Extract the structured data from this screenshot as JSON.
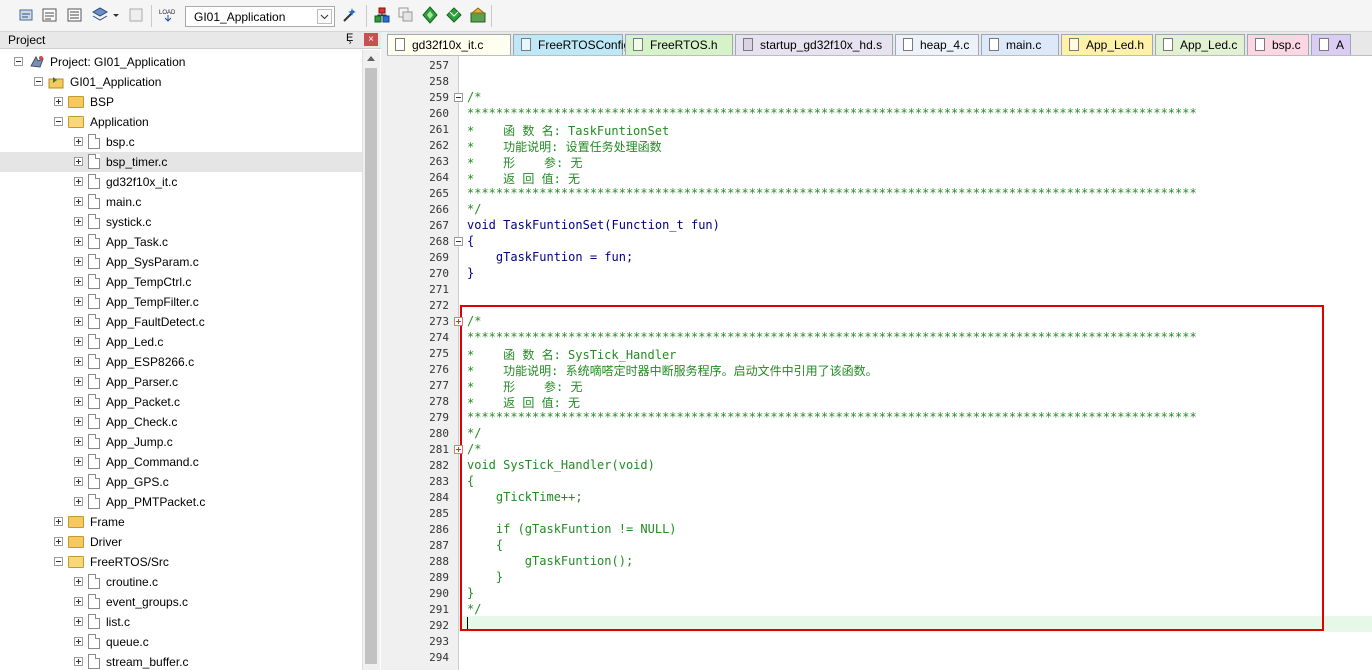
{
  "toolbar": {
    "target": "GI01_Application",
    "icons": [
      "translate-icon",
      "build-icon",
      "rebuild-icon",
      "batch-build-icon",
      "dropdown-arrow-icon",
      "stop-build-icon",
      "download-icon",
      "target-options-icon",
      "manage-components-icon",
      "file-extensions-icon",
      "select-packs-icon",
      "pack-installer-icon",
      "env-icon"
    ]
  },
  "project_panel": {
    "title": "Project",
    "pin": "Ȩ",
    "close": "×",
    "tree": [
      {
        "label": "Project: GI01_Application",
        "level": 0,
        "type": "project",
        "expanded": true
      },
      {
        "label": "GI01_Application",
        "level": 1,
        "type": "target",
        "expanded": true
      },
      {
        "label": "BSP",
        "level": 2,
        "type": "folder",
        "expanded": false
      },
      {
        "label": "Application",
        "level": 2,
        "type": "folder",
        "expanded": true
      },
      {
        "label": "bsp.c",
        "level": 3,
        "type": "file"
      },
      {
        "label": "bsp_timer.c",
        "level": 3,
        "type": "file",
        "selected": true
      },
      {
        "label": "gd32f10x_it.c",
        "level": 3,
        "type": "file"
      },
      {
        "label": "main.c",
        "level": 3,
        "type": "file"
      },
      {
        "label": "systick.c",
        "level": 3,
        "type": "file"
      },
      {
        "label": "App_Task.c",
        "level": 3,
        "type": "file"
      },
      {
        "label": "App_SysParam.c",
        "level": 3,
        "type": "file"
      },
      {
        "label": "App_TempCtrl.c",
        "level": 3,
        "type": "file"
      },
      {
        "label": "App_TempFilter.c",
        "level": 3,
        "type": "file"
      },
      {
        "label": "App_FaultDetect.c",
        "level": 3,
        "type": "file"
      },
      {
        "label": "App_Led.c",
        "level": 3,
        "type": "file"
      },
      {
        "label": "App_ESP8266.c",
        "level": 3,
        "type": "file"
      },
      {
        "label": "App_Parser.c",
        "level": 3,
        "type": "file"
      },
      {
        "label": "App_Packet.c",
        "level": 3,
        "type": "file"
      },
      {
        "label": "App_Check.c",
        "level": 3,
        "type": "file"
      },
      {
        "label": "App_Jump.c",
        "level": 3,
        "type": "file"
      },
      {
        "label": "App_Command.c",
        "level": 3,
        "type": "file"
      },
      {
        "label": "App_GPS.c",
        "level": 3,
        "type": "file"
      },
      {
        "label": "App_PMTPacket.c",
        "level": 3,
        "type": "file"
      },
      {
        "label": "Frame",
        "level": 2,
        "type": "folder",
        "expanded": false
      },
      {
        "label": "Driver",
        "level": 2,
        "type": "folder",
        "expanded": false
      },
      {
        "label": "FreeRTOS/Src",
        "level": 2,
        "type": "folder",
        "expanded": true
      },
      {
        "label": "croutine.c",
        "level": 3,
        "type": "file"
      },
      {
        "label": "event_groups.c",
        "level": 3,
        "type": "file"
      },
      {
        "label": "list.c",
        "level": 3,
        "type": "file"
      },
      {
        "label": "queue.c",
        "level": 3,
        "type": "file"
      },
      {
        "label": "stream_buffer.c",
        "level": 3,
        "type": "file"
      }
    ]
  },
  "tabs": [
    {
      "label": "gd32f10x_it.c",
      "color": "#fffff0",
      "icon": "#ffffff"
    },
    {
      "label": "FreeRTOSConfig.h",
      "color": "#bfe8f6",
      "icon": "#e6f6fb"
    },
    {
      "label": "FreeRTOS.h",
      "color": "#d6f2c8",
      "icon": "#f0fbea"
    },
    {
      "label": "startup_gd32f10x_hd.s",
      "color": "#e7e2f0",
      "icon": "#d9d3e5"
    },
    {
      "label": "heap_4.c",
      "color": "#ecf1fa",
      "icon": "#ffffff"
    },
    {
      "label": "main.c",
      "color": "#dde8f9",
      "icon": "#ffffff"
    },
    {
      "label": "App_Led.h",
      "color": "#fff2a8",
      "icon": "#fffbe0"
    },
    {
      "label": "App_Led.c",
      "color": "#e2f1d2",
      "icon": "#ffffff"
    },
    {
      "label": "bsp.c",
      "color": "#fcd7e3",
      "icon": "#ffffff"
    },
    {
      "label": "A",
      "color": "#d9cdf4",
      "icon": "#ffffff"
    }
  ],
  "editor": {
    "lines": [
      {
        "n": "257",
        "t": "",
        "s": "norm"
      },
      {
        "n": "258",
        "t": "",
        "s": "norm"
      },
      {
        "n": "259",
        "t": "/*",
        "s": "com",
        "fold": "open"
      },
      {
        "n": "260",
        "t": "*****************************************************************************************************",
        "s": "com"
      },
      {
        "n": "261",
        "t": "*    函 数 名: TaskFuntionSet",
        "s": "com"
      },
      {
        "n": "262",
        "t": "*    功能说明: 设置任务处理函数",
        "s": "com"
      },
      {
        "n": "263",
        "t": "*    形    参: 无",
        "s": "com"
      },
      {
        "n": "264",
        "t": "*    返 回 值: 无",
        "s": "com"
      },
      {
        "n": "265",
        "t": "*****************************************************************************************************",
        "s": "com"
      },
      {
        "n": "266",
        "t": "*/",
        "s": "com"
      },
      {
        "n": "267",
        "t": "void TaskFuntionSet(Function_t fun)",
        "s": "norm"
      },
      {
        "n": "268",
        "t": "{",
        "s": "norm",
        "fold": "open"
      },
      {
        "n": "269",
        "t": "    gTaskFuntion = fun;",
        "s": "norm"
      },
      {
        "n": "270",
        "t": "}",
        "s": "norm"
      },
      {
        "n": "271",
        "t": "",
        "s": "norm"
      },
      {
        "n": "272",
        "t": "",
        "s": "norm"
      },
      {
        "n": "273",
        "t": "/*",
        "s": "com",
        "fold": "closed"
      },
      {
        "n": "274",
        "t": "*****************************************************************************************************",
        "s": "com"
      },
      {
        "n": "275",
        "t": "*    函 数 名: SysTick_Handler",
        "s": "com"
      },
      {
        "n": "276",
        "t": "*    功能说明: 系统嘀嗒定时器中断服务程序。启动文件中引用了该函数。",
        "s": "com"
      },
      {
        "n": "277",
        "t": "*    形    参: 无",
        "s": "com"
      },
      {
        "n": "278",
        "t": "*    返 回 值: 无",
        "s": "com"
      },
      {
        "n": "279",
        "t": "*****************************************************************************************************",
        "s": "com"
      },
      {
        "n": "280",
        "t": "*/",
        "s": "com"
      },
      {
        "n": "281",
        "t": "/*",
        "s": "com",
        "fold": "closed"
      },
      {
        "n": "282",
        "t": "void SysTick_Handler(void)",
        "s": "com"
      },
      {
        "n": "283",
        "t": "{",
        "s": "com"
      },
      {
        "n": "284",
        "t": "    gTickTime++;",
        "s": "com"
      },
      {
        "n": "285",
        "t": "",
        "s": "com"
      },
      {
        "n": "286",
        "t": "    if (gTaskFuntion != NULL)",
        "s": "com"
      },
      {
        "n": "287",
        "t": "    {",
        "s": "com"
      },
      {
        "n": "288",
        "t": "        gTaskFuntion();",
        "s": "com"
      },
      {
        "n": "289",
        "t": "    }",
        "s": "com"
      },
      {
        "n": "290",
        "t": "}",
        "s": "com"
      },
      {
        "n": "291",
        "t": "*/",
        "s": "com"
      },
      {
        "n": "292",
        "t": "",
        "s": "norm"
      },
      {
        "n": "293",
        "t": "",
        "s": "norm"
      },
      {
        "n": "294",
        "t": "",
        "s": "norm"
      }
    ]
  },
  "colors": {
    "comment": "#228b22",
    "code": "#000080",
    "highlight_box": "#e00000",
    "current_line": "#e8f8e8"
  }
}
